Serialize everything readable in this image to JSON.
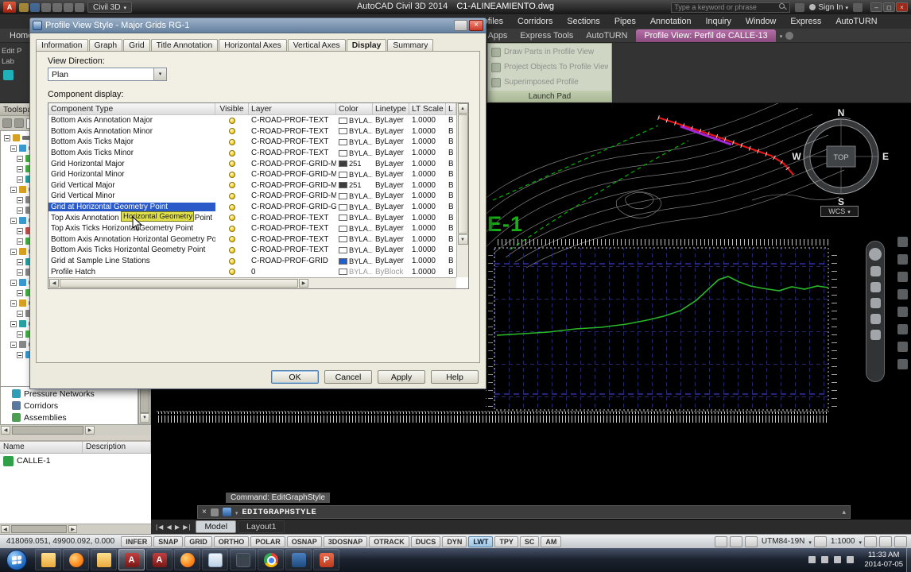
{
  "colors": {
    "selection": "#2a5ac8",
    "context_tab": "#8a4a7e",
    "profile_line": "#28b828",
    "alignment_line": "#e61414",
    "grid_line": "#26266a"
  },
  "titlebar": {
    "logo_label": "A",
    "workspace": "Civil 3D",
    "app_title": "AutoCAD Civil 3D 2014",
    "doc_title": "C1-ALINEAMIENTO.dwg",
    "search_placeholder": "Type a keyword or phrase",
    "signin_label": "Sign In"
  },
  "menubar": {
    "items": [
      "Profiles",
      "Corridors",
      "Sections",
      "Pipes",
      "Annotation",
      "Inquiry",
      "Window",
      "Express",
      "AutoTURN"
    ]
  },
  "ribbon": {
    "home_tab": "Home",
    "right_tabs": [
      "Featured Apps",
      "Express Tools",
      "AutoTURN"
    ],
    "context_tab": "Profile View: Perfil de CALLE-13",
    "panel": {
      "items": [
        "Draw Parts in Profile View",
        "Project Objects To Profile View",
        "Superimposed Profile"
      ],
      "title": "Launch Pad"
    },
    "left_fragments": [
      "Edit P",
      "Lab"
    ]
  },
  "toolspace": {
    "title": "Toolspace",
    "items": [
      {
        "label": "Pressure Networks",
        "color": "#2f9fb8"
      },
      {
        "label": "Corridors",
        "color": "#5878a0"
      },
      {
        "label": "Assemblies",
        "color": "#4aa050"
      }
    ]
  },
  "item_view": {
    "columns": [
      "Name",
      "Description"
    ],
    "rows": [
      {
        "name": "CALLE-1"
      }
    ]
  },
  "dialog": {
    "title": "Profile View Style - Major Grids RG-1",
    "tabs": [
      {
        "label": "Information"
      },
      {
        "label": "Graph"
      },
      {
        "label": "Grid"
      },
      {
        "label": "Title Annotation"
      },
      {
        "label": "Horizontal Axes"
      },
      {
        "label": "Vertical Axes"
      },
      {
        "label": "Display",
        "active": true
      },
      {
        "label": "Summary"
      }
    ],
    "view_direction_label": "View Direction:",
    "view_direction_value": "Plan",
    "component_display_label": "Component display:",
    "table": {
      "headers": [
        "Component Type",
        "Visible",
        "Layer",
        "Color",
        "Linetype",
        "LT Scale",
        "L"
      ],
      "rows": [
        {
          "type": "Bottom Axis Annotation Major",
          "layer": "C-ROAD-PROF-TEXT",
          "color": "BYLA...",
          "swatch": "#ffffff",
          "linetype": "ByLayer",
          "lt_scale": "1.0000",
          "last": "B"
        },
        {
          "type": "Bottom Axis Annotation Minor",
          "layer": "C-ROAD-PROF-TEXT",
          "color": "BYLA...",
          "swatch": "#ffffff",
          "linetype": "ByLayer",
          "lt_scale": "1.0000",
          "last": "B"
        },
        {
          "type": "Bottom Axis Ticks Major",
          "layer": "C-ROAD-PROF-TEXT",
          "color": "BYLA...",
          "swatch": "#ffffff",
          "linetype": "ByLayer",
          "lt_scale": "1.0000",
          "last": "B"
        },
        {
          "type": "Bottom Axis Ticks Minor",
          "layer": "C-ROAD-PROF-TEXT",
          "color": "BYLA...",
          "swatch": "#ffffff",
          "linetype": "ByLayer",
          "lt_scale": "1.0000",
          "last": "B"
        },
        {
          "type": "Grid Horizontal Major",
          "layer": "C-ROAD-PROF-GRID-MAJR",
          "color": "251",
          "swatch": "#3d3d3d",
          "linetype": "ByLayer",
          "lt_scale": "1.0000",
          "last": "B"
        },
        {
          "type": "Grid Horizontal Minor",
          "layer": "C-ROAD-PROF-GRID-MINR",
          "color": "BYLA...",
          "swatch": "#ffffff",
          "linetype": "ByLayer",
          "lt_scale": "1.0000",
          "last": "B"
        },
        {
          "type": "Grid Vertical Major",
          "layer": "C-ROAD-PROF-GRID-MAJR",
          "color": "251",
          "swatch": "#3d3d3d",
          "linetype": "ByLayer",
          "lt_scale": "1.0000",
          "last": "B"
        },
        {
          "type": "Grid Vertical Minor",
          "layer": "C-ROAD-PROF-GRID-MINR",
          "color": "BYLA...",
          "swatch": "#ffffff",
          "linetype": "ByLayer",
          "lt_scale": "1.0000",
          "last": "B"
        },
        {
          "type": "Grid at Horizontal Geometry Point",
          "layer": "C-ROAD-PROF-GRID-GEOM",
          "color": "BYLA...",
          "swatch": "#ffffff",
          "linetype": "ByLayer",
          "lt_scale": "1.0000",
          "last": "B",
          "selected": true
        },
        {
          "type": "Top Axis Annotation Horizontal Geometry Point",
          "layer": "C-ROAD-PROF-TEXT",
          "color": "BYLA...",
          "swatch": "#ffffff",
          "linetype": "ByLayer",
          "lt_scale": "1.0000",
          "last": "B"
        },
        {
          "type": "Top Axis Ticks Horizontal Geometry Point",
          "layer": "C-ROAD-PROF-TEXT",
          "color": "BYLA...",
          "swatch": "#ffffff",
          "linetype": "ByLayer",
          "lt_scale": "1.0000",
          "last": "B"
        },
        {
          "type": "Bottom Axis Annotation Horizontal Geometry Point",
          "layer": "C-ROAD-PROF-TEXT",
          "color": "BYLA...",
          "swatch": "#ffffff",
          "linetype": "ByLayer",
          "lt_scale": "1.0000",
          "last": "B"
        },
        {
          "type": "Bottom Axis Ticks Horizontal Geometry Point",
          "layer": "C-ROAD-PROF-TEXT",
          "color": "BYLA...",
          "swatch": "#ffffff",
          "linetype": "ByLayer",
          "lt_scale": "1.0000",
          "last": "B"
        },
        {
          "type": "Grid at Sample Line Stations",
          "layer": "C-ROAD-PROF-GRID",
          "color": "BYLA...",
          "swatch": "#1f5fd0",
          "linetype": "ByLayer",
          "lt_scale": "1.0000",
          "last": "B"
        },
        {
          "type": "Profile Hatch",
          "layer": "0",
          "color": "BYLA...",
          "swatch": "#ffffff",
          "linetype": "ByBlock",
          "lt_scale": "1.0000",
          "last": "B",
          "disabled": true
        }
      ]
    },
    "tooltip": "Horizontal Geometry Point",
    "buttons": [
      "OK",
      "Cancel",
      "Apply",
      "Help"
    ]
  },
  "drawing": {
    "viewcube": {
      "north": "N",
      "south": "S",
      "east": "E",
      "west": "W",
      "top": "TOP"
    },
    "wcs_label": "WCS",
    "profile_label": "E-1"
  },
  "command": {
    "prompt": "Command: EditGraphStyle",
    "input": "EDITGRAPHSTYLE"
  },
  "layout_tabs": {
    "items": [
      {
        "label": "Model",
        "active": true
      },
      {
        "label": "Layout1"
      }
    ]
  },
  "statusbar": {
    "coordinates": "418069.051, 49900.092, 0.000",
    "toggles": [
      {
        "label": "INFER"
      },
      {
        "label": "SNAP"
      },
      {
        "label": "GRID"
      },
      {
        "label": "ORTHO"
      },
      {
        "label": "POLAR"
      },
      {
        "label": "OSNAP"
      },
      {
        "label": "3DOSNAP"
      },
      {
        "label": "OTRACK"
      },
      {
        "label": "DUCS"
      },
      {
        "label": "DYN"
      },
      {
        "label": "LWT",
        "on": true
      },
      {
        "label": "TPY"
      },
      {
        "label": "SC"
      },
      {
        "label": "AM"
      }
    ],
    "coordinate_system": "UTM84-19N",
    "annotation_scale": "1:1000"
  },
  "taskbar": {
    "apps": [
      {
        "name": "explorer",
        "kind": "folder"
      },
      {
        "name": "firefox",
        "kind": "firefox"
      },
      {
        "name": "folder",
        "kind": "folder"
      },
      {
        "name": "autocad-civil3d",
        "kind": "autocad",
        "glyph": "A",
        "active": true
      },
      {
        "name": "autocad",
        "kind": "autocad",
        "glyph": "A"
      },
      {
        "name": "firefox-2",
        "kind": "firefox"
      },
      {
        "name": "document-app",
        "kind": "doc"
      },
      {
        "name": "utility-app",
        "kind": "dark"
      },
      {
        "name": "chrome",
        "kind": "chrome"
      },
      {
        "name": "remote-desktop",
        "kind": "remote"
      },
      {
        "name": "powerpoint",
        "kind": "ppt",
        "glyph": "P"
      }
    ],
    "clock_time": "11:33 AM",
    "clock_date": "2014-07-05"
  }
}
